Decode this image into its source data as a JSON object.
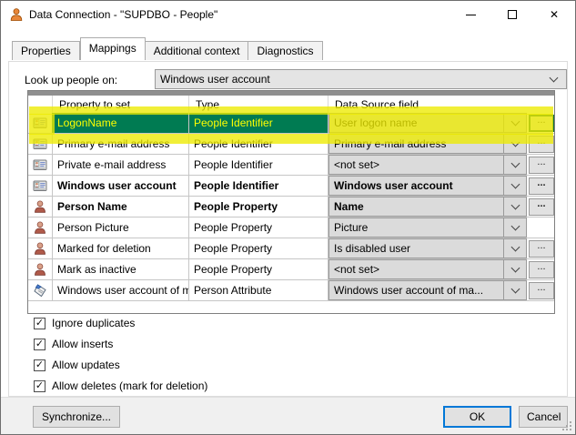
{
  "window": {
    "title": "Data Connection - \"SUPDBO - People\"",
    "icon": "person-orange",
    "controls": [
      "minimize",
      "maximize",
      "close"
    ]
  },
  "tabs": [
    {
      "label": "Properties",
      "active": false
    },
    {
      "label": "Mappings",
      "active": true
    },
    {
      "label": "Additional context",
      "active": false
    },
    {
      "label": "Diagnostics",
      "active": false
    }
  ],
  "lookup": {
    "label": "Look up people on:",
    "value": "Windows user account"
  },
  "grid": {
    "columns": [
      "Property to set",
      "Type",
      "Data Source field"
    ],
    "dots_label": "...",
    "rows": [
      {
        "icon": "id-card",
        "property": "LogonName",
        "type": "People Identifier",
        "source": "User logon name",
        "bold": false,
        "selected": true,
        "highlighted": true,
        "has_dots": true
      },
      {
        "icon": "id-card",
        "property": "Primary e-mail address",
        "type": "People Identifier",
        "source": "Primary e-mail address",
        "bold": false,
        "selected": false,
        "highlighted": false,
        "has_dots": true
      },
      {
        "icon": "id-card",
        "property": "Private e-mail address",
        "type": "People Identifier",
        "source": "<not set>",
        "bold": false,
        "selected": false,
        "highlighted": false,
        "has_dots": true
      },
      {
        "icon": "id-card",
        "property": "Windows user account",
        "type": "People Identifier",
        "source": "Windows user account",
        "bold": true,
        "selected": false,
        "highlighted": false,
        "has_dots": true
      },
      {
        "icon": "person",
        "property": "Person Name",
        "type": "People Property",
        "source": "Name",
        "bold": true,
        "selected": false,
        "highlighted": false,
        "has_dots": true
      },
      {
        "icon": "person",
        "property": "Person Picture",
        "type": "People Property",
        "source": "Picture",
        "bold": false,
        "selected": false,
        "highlighted": false,
        "has_dots": false
      },
      {
        "icon": "person",
        "property": "Marked for deletion",
        "type": "People Property",
        "source": "Is disabled user",
        "bold": false,
        "selected": false,
        "highlighted": false,
        "has_dots": true
      },
      {
        "icon": "person",
        "property": "Mark as inactive",
        "type": "People Property",
        "source": "<not set>",
        "bold": false,
        "selected": false,
        "highlighted": false,
        "has_dots": true
      },
      {
        "icon": "tag",
        "property": "Windows user account of manager",
        "type": "Person Attribute",
        "source": "Windows user account of ma...",
        "bold": false,
        "selected": false,
        "highlighted": false,
        "has_dots": true
      }
    ]
  },
  "options": [
    {
      "label": "Ignore duplicates",
      "checked": true
    },
    {
      "label": "Allow inserts",
      "checked": true
    },
    {
      "label": "Allow updates",
      "checked": true
    },
    {
      "label": "Allow deletes (mark for deletion)",
      "checked": true
    }
  ],
  "footer": {
    "synchronize": "Synchronize...",
    "ok": "OK",
    "cancel": "Cancel"
  },
  "icons": {
    "check": "✓",
    "close": "✕",
    "ellipsis": "..."
  },
  "colors": {
    "selection_bg": "#007b52",
    "selection_text": "#ffff00",
    "highlight": "#edeb00",
    "focus_border": "#0078d7",
    "combo_bg": "#dbdbdb"
  }
}
